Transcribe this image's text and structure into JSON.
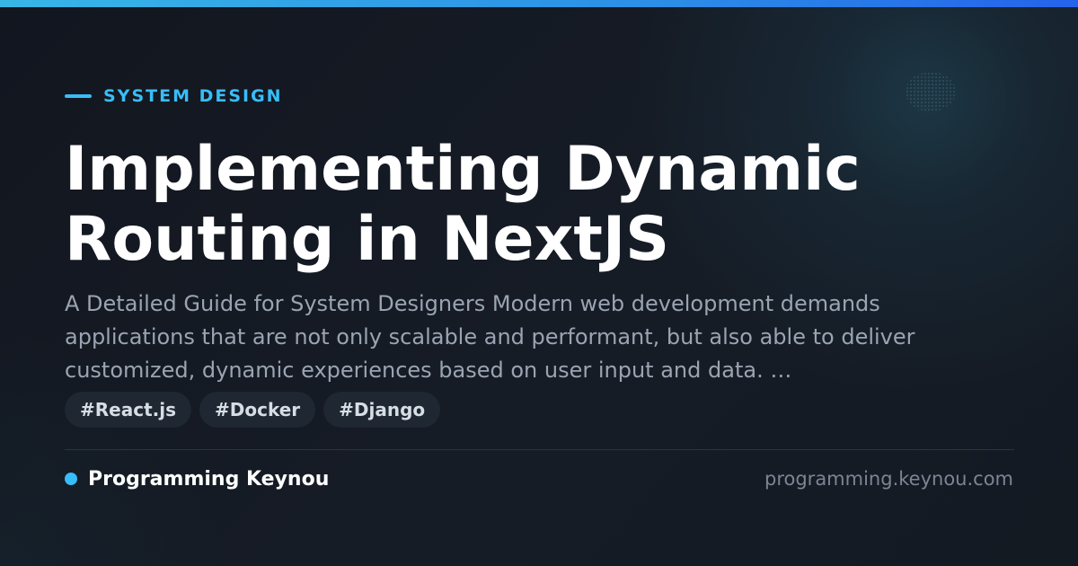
{
  "colors": {
    "accent": "#38bdf8",
    "background": "#141a22",
    "title": "#ffffff",
    "description": "#9aa4b2",
    "tag_background": "#1e2732",
    "tag_text": "#d7dde5",
    "url_text": "#7b8594"
  },
  "category": {
    "label": "SYSTEM DESIGN"
  },
  "article": {
    "title": "Implementing Dynamic Routing in NextJS",
    "description": "A Detailed Guide for System Designers Modern web development demands applications that are not only scalable and performant, but also able to deliver customized, dynamic experiences based on user input and data. …",
    "tags": [
      "#React.js",
      "#Docker",
      "#Django"
    ]
  },
  "footer": {
    "brand": "Programming Keynou",
    "url": "programming.keynou.com"
  }
}
